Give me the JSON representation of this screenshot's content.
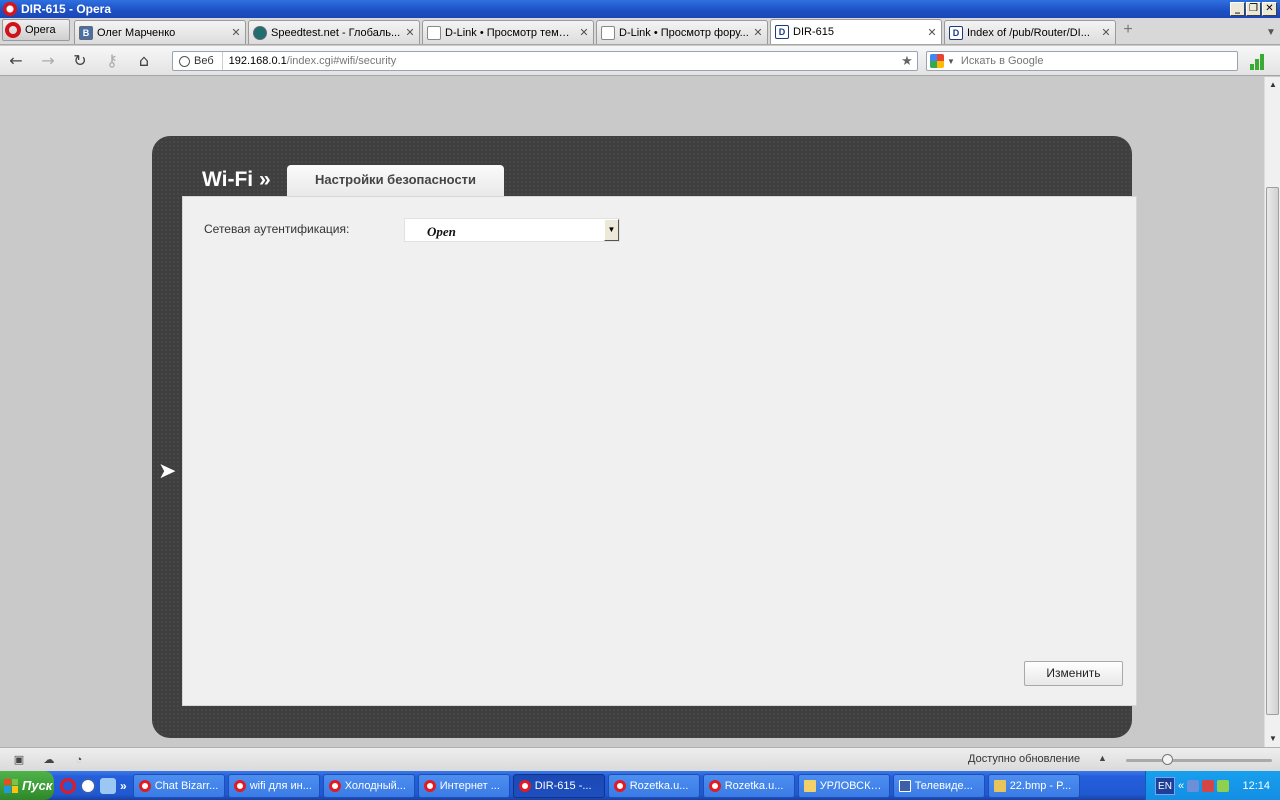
{
  "window": {
    "title": "DIR-615 - Opera"
  },
  "browser": {
    "menu_label": "Opera",
    "tabs": [
      {
        "label": "Олег Марченко",
        "icon": "vk-icon"
      },
      {
        "label": "Speedtest.net - Глобаль...",
        "icon": "speedtest-icon"
      },
      {
        "label": "D-Link • Просмотр темы ...",
        "icon": "document-icon"
      },
      {
        "label": "D-Link • Просмотр фору...",
        "icon": "document-icon"
      },
      {
        "label": "DIR-615",
        "icon": "dlink-icon",
        "active": true
      },
      {
        "label": "Index of /pub/Router/DI...",
        "icon": "dlink-icon"
      }
    ],
    "address": {
      "badge": "Веб",
      "host": "192.168.0.1",
      "path": "/index.cgi#wifi/security"
    },
    "search": {
      "placeholder": "Искать в Google"
    }
  },
  "page": {
    "section_title": "Wi-Fi »",
    "tab_label": "Настройки безопасности",
    "auth_label": "Сетевая аутентификация:",
    "auth_value": "Open",
    "change_button": "Изменить"
  },
  "statusbar": {
    "update_text": "Доступно обновление"
  },
  "taskbar": {
    "start_label": "Пуск",
    "tasks": [
      {
        "label": "Chat Bizarr...",
        "icon": "opera"
      },
      {
        "label": "wifi для ин...",
        "icon": "opera"
      },
      {
        "label": "Холодный...",
        "icon": "opera"
      },
      {
        "label": "Интернет ...",
        "icon": "opera"
      },
      {
        "label": "DIR-615 -...",
        "icon": "opera",
        "active": true
      },
      {
        "label": "Rozetka.u...",
        "icon": "opera"
      },
      {
        "label": "Rozetka.u...",
        "icon": "opera"
      },
      {
        "label": "УРЛОВСКАЯ",
        "icon": "folder"
      },
      {
        "label": "Телевиде...",
        "icon": "doc"
      },
      {
        "label": "22.bmp - P...",
        "icon": "paint"
      }
    ],
    "language": "EN",
    "clock": "12:14"
  }
}
